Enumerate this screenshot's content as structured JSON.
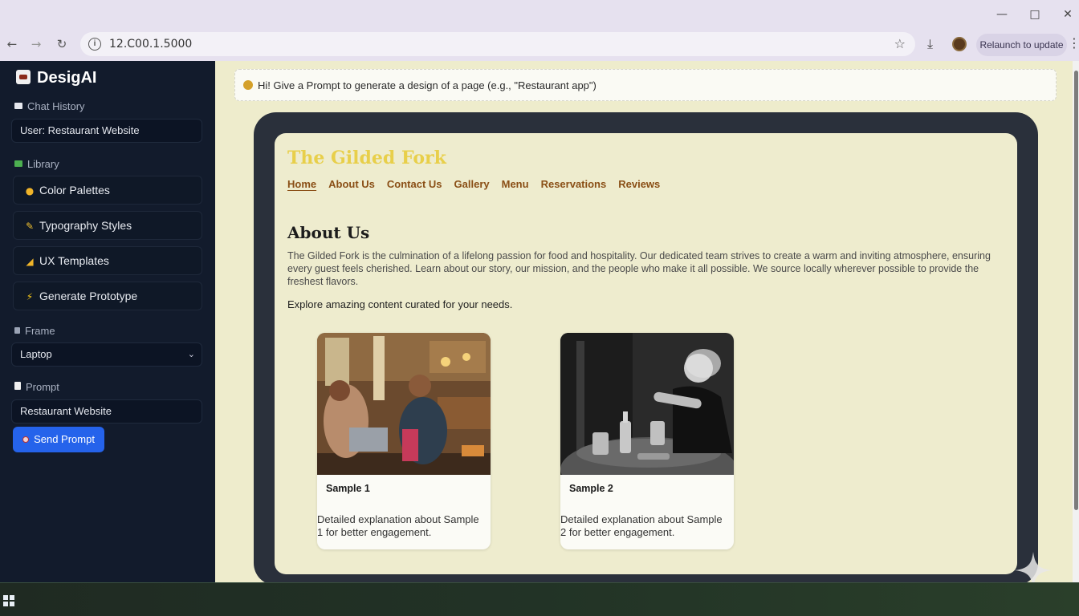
{
  "browser": {
    "url": "12.C00.1.5000",
    "relaunch_label": "Relaunch to update"
  },
  "sidebar": {
    "brand": "DesigAI",
    "chat_history_label": "Chat History",
    "chat_history_item": "User: Restaurant Website",
    "library_label": "Library",
    "library_items": [
      {
        "label": "Color Palettes",
        "icon": "palette-icon"
      },
      {
        "label": "Typography Styles",
        "icon": "pencil-icon"
      },
      {
        "label": "UX Templates",
        "icon": "ruler-icon"
      },
      {
        "label": "Generate Prototype",
        "icon": "lightning-icon"
      }
    ],
    "frame_label": "Frame",
    "frame_value": "Laptop",
    "prompt_label": "Prompt",
    "prompt_value": "Restaurant Website",
    "send_label": "Send Prompt"
  },
  "main": {
    "hint": "Hi! Give a Prompt to generate a design of a page (e.g., \"Restaurant app\")"
  },
  "preview": {
    "site_title": "The Gilded Fork",
    "nav": [
      "Home",
      "About Us",
      "Contact Us",
      "Gallery",
      "Menu",
      "Reservations",
      "Reviews"
    ],
    "heading": "About Us",
    "paragraph": "The Gilded Fork is the culmination of a lifelong passion for food and hospitality. Our dedicated team strives to create a warm and inviting atmosphere, ensuring every guest feels cherished. Learn about our story, our mission, and the people who make it all possible. We source locally wherever possible to provide the freshest flavors.",
    "explore": "Explore amazing content curated for your needs.",
    "cards": [
      {
        "title": "Sample 1",
        "desc": "Detailed explanation about Sample 1 for better engagement."
      },
      {
        "title": "Sample 2",
        "desc": "Detailed explanation about Sample 2 for better engagement."
      }
    ]
  },
  "colors": {
    "sidebar_bg": "#121b2c",
    "accent": "#2563eb",
    "site_title": "#e8cf4a",
    "nav_link": "#8a4f16",
    "preview_bg": "#eeecce"
  }
}
